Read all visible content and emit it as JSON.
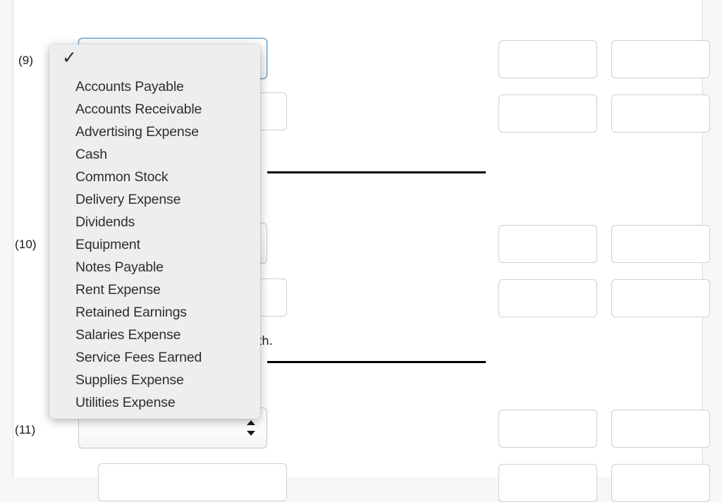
{
  "form": {
    "rows": [
      {
        "id": "9",
        "label": "(9)",
        "account_value": "",
        "explanation": ""
      },
      {
        "id": "10",
        "label": "(10)",
        "account_value": "",
        "explanation": "se to be paid following month."
      },
      {
        "id": "11",
        "label": "(11)",
        "account_value": "",
        "explanation": ""
      }
    ],
    "amount_placeholder": ""
  },
  "dropdown": {
    "selected_label": "",
    "checkmark_glyph": "✓",
    "options": [
      "Accounts Payable",
      "Accounts Receivable",
      "Advertising Expense",
      "Cash",
      "Common Stock",
      "Delivery Expense",
      "Dividends",
      "Equipment",
      "Notes Payable",
      "Rent Expense",
      "Retained Earnings",
      "Salaries Expense",
      "Service Fees Earned",
      "Supplies Expense",
      "Utilities Expense"
    ]
  },
  "colors": {
    "page_background": "#f7f7f7",
    "sheet_background": "#ffffff",
    "focus_border": "#5a9fd4",
    "input_border": "#cfcfcf",
    "dropdown_background": "#eeeeee",
    "rule_color": "#000000",
    "text_color": "#2e2e2e"
  }
}
